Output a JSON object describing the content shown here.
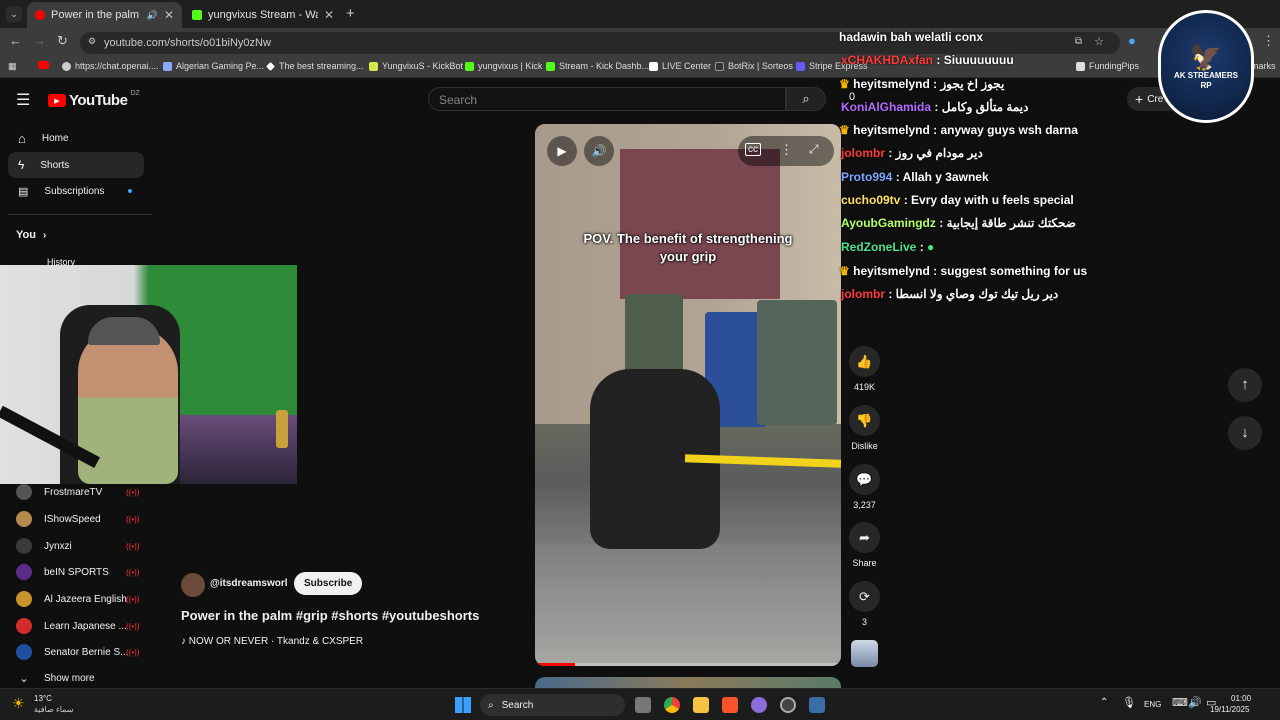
{
  "browser": {
    "tabs": [
      {
        "title": "Power in the palm #grip #s",
        "active": true
      },
      {
        "title": "yungvixus Stream - Watch Live",
        "active": false
      }
    ],
    "url": "youtube.com/shorts/o01biNy0zNw",
    "bookmarks": [
      "https://chat.openai....",
      "Algerian Gaming Pe...",
      "The best streaming...",
      "YungvixuS - KickBot",
      "yungvixus | Kick",
      "Stream - Kick Dashb...",
      "LIVE Center",
      "BotRix | Sorteos",
      "Stripe Express",
      "FundingPips",
      "marks"
    ]
  },
  "youtube": {
    "logo": "YouTube",
    "region": "DZ",
    "search_placeholder": "Search",
    "create_label": "Cre",
    "sidebar": {
      "home": "Home",
      "shorts": "Shorts",
      "subscriptions": "Subscriptions",
      "you": "You",
      "history": "History",
      "channels": [
        "FrostmareTV",
        "IShowSpeed",
        "Jynxzi",
        "beIN SPORTS",
        "Al Jazeera English",
        "Learn Japanese ...",
        "Senator Bernie S..."
      ],
      "show_more": "Show more"
    },
    "video": {
      "caption": "POV. The benefit of strengthening your grip",
      "channel": "@itsdreamsworl",
      "subscribe": "Subscribe",
      "title": "Power in the palm #grip #shorts #youtubeshorts",
      "music": "NOW OR NEVER · Tkandz & CXSPER",
      "likes": "419K",
      "dislike": "Dislike",
      "comments": "3,237",
      "share": "Share",
      "remix": "3"
    }
  },
  "overlay": {
    "chat_header": "hadawin bah welatli conx",
    "messages": [
      {
        "user": "xCHAKHDAxfan",
        "text": "Siuuuuuuuu",
        "color": "#ff3b3b",
        "badge": false
      },
      {
        "user": "heyitsmelynd",
        "text": "يجوز اخ يجوز",
        "color": "#e6e6e6",
        "badge": true
      },
      {
        "user": "KoniAlGhamida",
        "text": "ديمة متألق وكامل",
        "color": "#b46cff",
        "badge": false
      },
      {
        "user": "heyitsmelynd",
        "text": "anyway guys wsh darna",
        "color": "#e6e6e6",
        "badge": true
      },
      {
        "user": "jolombr",
        "text": "دير مودام في روز",
        "color": "#ff3b3b",
        "badge": false
      },
      {
        "user": "Proto994",
        "text": "Allah y 3awnek",
        "color": "#7fa7ff",
        "badge": false
      },
      {
        "user": "cucho09tv",
        "text": "Evry day with u feels special",
        "color": "#ffe066",
        "badge": false
      },
      {
        "user": "AyoubGamingdz",
        "text": "ضحكتك تنشر طاقة إيجابية",
        "color": "#b6ff6a",
        "badge": false
      },
      {
        "user": "RedZoneLive",
        "text": "",
        "color": "#4de08a",
        "badge": false
      },
      {
        "user": "heyitsmelynd",
        "text": "suggest something for us",
        "color": "#e6e6e6",
        "badge": true
      },
      {
        "user": "jolombr",
        "text": "دير ريل تيك توك وصاي ولا انسطا",
        "color": "#ff3b3b",
        "badge": false
      }
    ],
    "logo_text": "AK STREAMERS RP",
    "counter": "0"
  },
  "taskbar": {
    "weather_temp": "13°C",
    "weather_desc": "سماء صافية",
    "search": "Search",
    "lang": "ENG",
    "time": "01:00",
    "date": "19/11/2025"
  }
}
